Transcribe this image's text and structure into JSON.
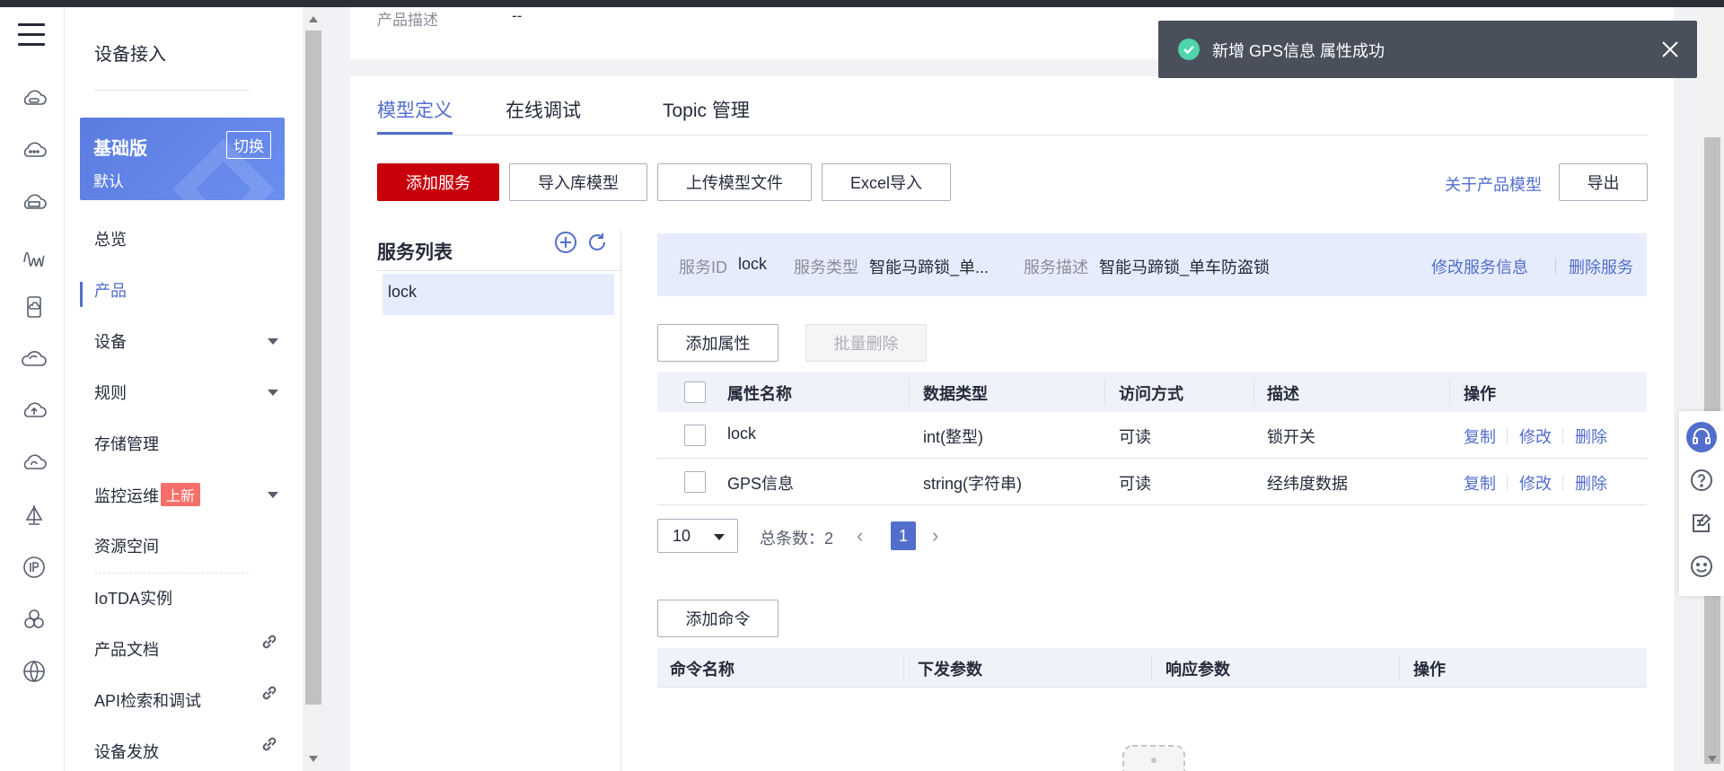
{
  "nav": {
    "title": "设备接入",
    "plan_name": "基础版",
    "plan_sub": "默认",
    "plan_switch": "切换",
    "items": [
      {
        "label": "总览"
      },
      {
        "label": "产品"
      },
      {
        "label": "设备"
      },
      {
        "label": "规则"
      },
      {
        "label": "存储管理"
      },
      {
        "label": "监控运维",
        "badge": "上新"
      },
      {
        "label": "资源空间"
      },
      {
        "label": "IoTDA实例"
      },
      {
        "label": "产品文档"
      },
      {
        "label": "API检索和调试"
      },
      {
        "label": "设备发放"
      }
    ]
  },
  "top_card": {
    "label": "产品描述",
    "value": "--"
  },
  "tabs": [
    "模型定义",
    "在线调试",
    "Topic 管理"
  ],
  "toolbar": {
    "add_service": "添加服务",
    "import_lib": "导入库模型",
    "upload_model": "上传模型文件",
    "excel_import": "Excel导入",
    "about_model": "关于产品模型",
    "export": "导出"
  },
  "service_list": {
    "title": "服务列表",
    "items": [
      "lock"
    ]
  },
  "service_info": {
    "id_label": "服务ID",
    "id": "lock",
    "type_label": "服务类型",
    "type": "智能马蹄锁_单...",
    "desc_label": "服务描述",
    "desc": "智能马蹄锁_单车防盗锁",
    "edit": "修改服务信息",
    "delete": "删除服务"
  },
  "property_actions": {
    "add": "添加属性",
    "batch_delete": "批量删除"
  },
  "property_table": {
    "headers": [
      "属性名称",
      "数据类型",
      "访问方式",
      "描述",
      "操作"
    ],
    "rows": [
      {
        "name": "lock",
        "type": "int(整型)",
        "access": "可读",
        "desc": "锁开关"
      },
      {
        "name": "GPS信息",
        "type": "string(字符串)",
        "access": "可读",
        "desc": "经纬度数据"
      }
    ],
    "ops": [
      "复制",
      "修改",
      "删除"
    ]
  },
  "pager": {
    "page_size": "10",
    "total_label": "总条数：",
    "total": "2",
    "prev": "‹",
    "current": "1",
    "next": "›"
  },
  "command": {
    "add": "添加命令",
    "headers": [
      "命令名称",
      "下发参数",
      "响应参数",
      "操作"
    ]
  },
  "toast": {
    "message": "新增 GPS信息 属性成功"
  },
  "colors": {
    "primary": "#c7000b",
    "accent": "#526ecc",
    "success": "#50d4ab"
  }
}
